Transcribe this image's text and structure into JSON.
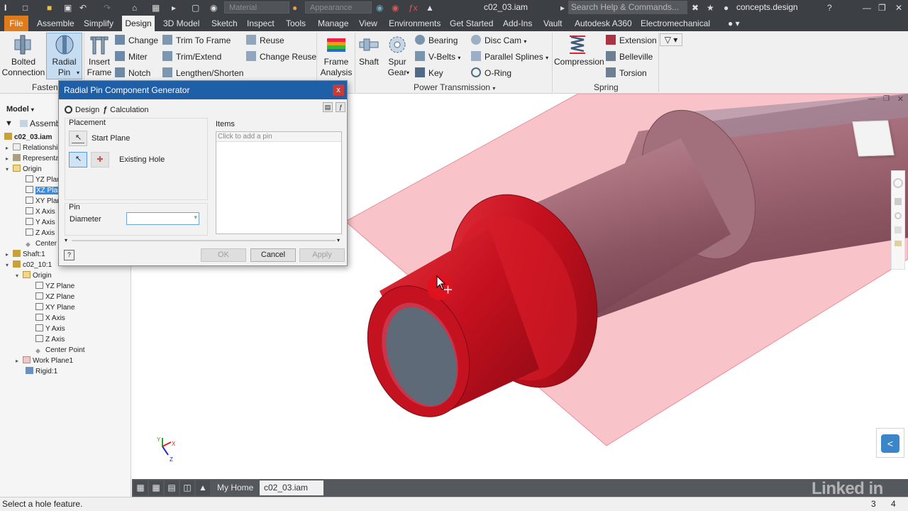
{
  "titlebar": {
    "material_placeholder": "Material",
    "appearance_placeholder": "Appearance",
    "doc_title": "c02_03.iam",
    "search_placeholder": "Search Help & Commands...",
    "user": "concepts.design"
  },
  "menu": {
    "file": "File",
    "tabs": [
      "Assemble",
      "Simplify",
      "Design",
      "3D Model",
      "Sketch",
      "Inspect",
      "Tools",
      "Manage",
      "View",
      "Environments",
      "Get Started",
      "Add-Ins",
      "Vault",
      "Autodesk A360",
      "Electromechanical"
    ],
    "active": "Design"
  },
  "ribbon": {
    "bolted_connection": [
      "Bolted",
      "Connection"
    ],
    "radial_pin": [
      "Radial",
      "Pin"
    ],
    "insert_frame": [
      "Insert",
      "Frame"
    ],
    "change": "Change",
    "miter": "Miter",
    "notch": "Notch",
    "trim_to_frame": "Trim To Frame",
    "trim_extend": "Trim/Extend",
    "lengthen_shorten": "Lengthen/Shorten",
    "reuse": "Reuse",
    "change_reuse": "Change Reuse",
    "frame_analysis": [
      "Frame",
      "Analysis"
    ],
    "shaft": "Shaft",
    "spur_gear": [
      "Spur",
      "Gear"
    ],
    "bearing": "Bearing",
    "v_belts": "V-Belts",
    "key": "Key",
    "disc_cam": "Disc Cam",
    "parallel_splines": "Parallel Splines",
    "o_ring": "O-Ring",
    "compression": "Compression",
    "extension": "Extension",
    "belleville": "Belleville",
    "torsion": "Torsion",
    "panels": {
      "fasten": "Fasten",
      "power_transmission": "Power Transmission",
      "spring": "Spring"
    }
  },
  "browser": {
    "header": "Model",
    "rows": [
      {
        "label": "Assemb"
      },
      {
        "label": "c02_03.iam"
      },
      {
        "label": "Relationshi"
      },
      {
        "label": "Representa"
      },
      {
        "label": "Origin"
      },
      {
        "label": "YZ Plan"
      },
      {
        "label": "XZ Plan"
      },
      {
        "label": "XY Plan"
      },
      {
        "label": "X Axis"
      },
      {
        "label": "Y Axis"
      },
      {
        "label": "Z Axis"
      },
      {
        "label": "Center"
      },
      {
        "label": "Shaft:1"
      },
      {
        "label": "c02_10:1"
      },
      {
        "label": "Origin"
      },
      {
        "label": "YZ Plane"
      },
      {
        "label": "XZ Plane"
      },
      {
        "label": "XY Plane"
      },
      {
        "label": "X Axis"
      },
      {
        "label": "Y Axis"
      },
      {
        "label": "Z Axis"
      },
      {
        "label": "Center Point"
      },
      {
        "label": "Work Plane1"
      },
      {
        "label": "Rigid:1"
      }
    ]
  },
  "dialog": {
    "title": "Radial Pin Component Generator",
    "close": "x",
    "tab_design": "Design",
    "tab_calculation": "Calculation",
    "placement_label": "Placement",
    "start_plane": "Start Plane",
    "existing_hole": "Existing Hole",
    "items_label": "Items",
    "items_placeholder": "Click to add a pin",
    "pin_label": "Pin",
    "diameter_label": "Diameter",
    "ok": "OK",
    "cancel": "Cancel",
    "apply": "Apply"
  },
  "doctabs": {
    "my_home": "My Home",
    "doc": "c02_03.iam"
  },
  "status": {
    "message": "Select a hole feature.",
    "num_a": "3",
    "num_b": "4"
  },
  "watermark": "Linked in",
  "colors": {
    "accent_file": "#e07b1d",
    "dialog_title": "#1f5fa8",
    "part_red": "#c8101e",
    "workplane": "#f6b8bf",
    "selection": "#3b8de0"
  }
}
